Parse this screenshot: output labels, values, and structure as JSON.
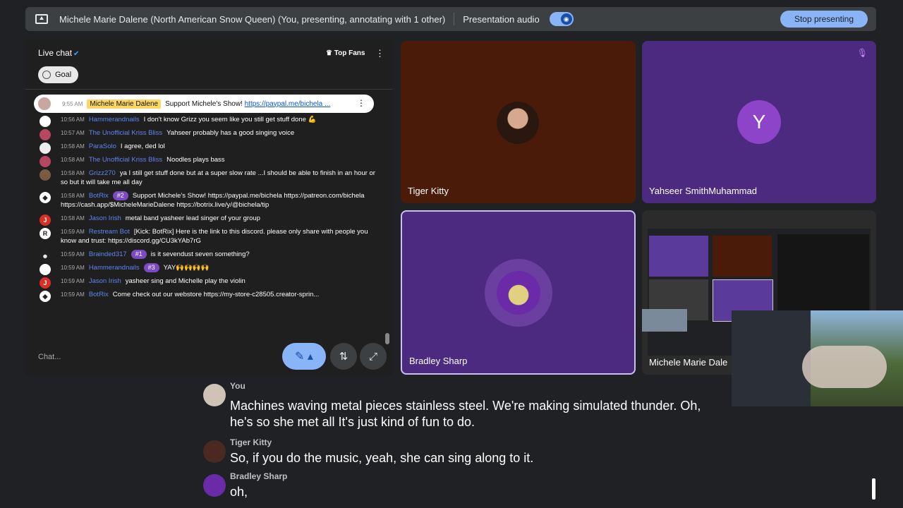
{
  "topbar": {
    "title": "Michele Marie Dalene (North American Snow Queen) (You, presenting, annotating with 1 other)",
    "audio_label": "Presentation audio",
    "stop_label": "Stop presenting"
  },
  "chat": {
    "header": "Live chat",
    "top_fans": "Top Fans",
    "goal": "Goal",
    "pinned": {
      "time": "9:55 AM",
      "name": "Michele Marie Dalene",
      "text": "Support Michele's Show! ",
      "link": "https://paypal.me/bichela ..."
    },
    "messages": [
      {
        "time": "10:56 AM",
        "user": "Hammerandnails",
        "badge": "",
        "text": "I don't know Grizz you seem like you still get stuff done 💪"
      },
      {
        "time": "10:57 AM",
        "user": "The Unofficial Kriss Bliss",
        "badge": "",
        "text": "Yahseer probably has a good singing voice"
      },
      {
        "time": "10:58 AM",
        "user": "ParaSolo",
        "badge": "",
        "text": "I agree, ded lol"
      },
      {
        "time": "10:58 AM",
        "user": "The Unofficial Kriss Bliss",
        "badge": "",
        "text": "Noodles plays bass"
      },
      {
        "time": "10:58 AM",
        "user": "Grizz270",
        "badge": "",
        "text": "ya I still get stuff done but at a super slow rate ...I should be able to finish in an hour or so but it will take me all day"
      },
      {
        "time": "10:58 AM",
        "user": "BotRix",
        "badge": "#2",
        "text": "Support Michele's Show! https://paypal.me/bichela https://patreon.com/bichela https://cash.app/$MicheleMarieDalene https://botrix.live/y/@bichela/tip"
      },
      {
        "time": "10:58 AM",
        "user": "Jason Irish",
        "badge": "",
        "text": "metal band yasheer lead singer of your group"
      },
      {
        "time": "10:59 AM",
        "user": "Restream Bot",
        "badge": "",
        "text": "[Kick: BotRix] Here is the link to this discord. please only share with people you know and trust: https://discord.gg/CU3kYAb7rG"
      },
      {
        "time": "10:59 AM",
        "user": "Brainded317",
        "badge": "#1",
        "text": "is it sevendust seven something?"
      },
      {
        "time": "10:59 AM",
        "user": "Hammerandnails",
        "badge": "#3",
        "text": "YAY🙌🙌🙌🙌"
      },
      {
        "time": "10:59 AM",
        "user": "Jason Irish",
        "badge": "",
        "text": "yasheer sing and Michelle play the violin"
      },
      {
        "time": "10:59 AM",
        "user": "BotRix",
        "badge": "",
        "text": "Come check out our webstore https://my-store-c28505.creator-sprin..."
      }
    ],
    "input_placeholder": "Chat..."
  },
  "tiles": {
    "t1": "Tiger Kitty",
    "t2": "Yahseer SmithMuhammad",
    "t2_letter": "Y",
    "t3": "Bradley Sharp",
    "t4": "Michele Marie Dale"
  },
  "captions": [
    {
      "who": "You",
      "text": "Machines waving metal pieces stainless steel. We're making simulated thunder. Oh, he's so she met all It's just kind of fun to do."
    },
    {
      "who": "Tiger Kitty",
      "text": "So, if you do the music, yeah, she can sing along to it."
    },
    {
      "who": "Bradley Sharp",
      "text": "oh,"
    }
  ],
  "colors": {
    "accent": "#8ab4f8",
    "tile_purple": "#4b2a80",
    "tile_brown": "#4a1b08"
  }
}
